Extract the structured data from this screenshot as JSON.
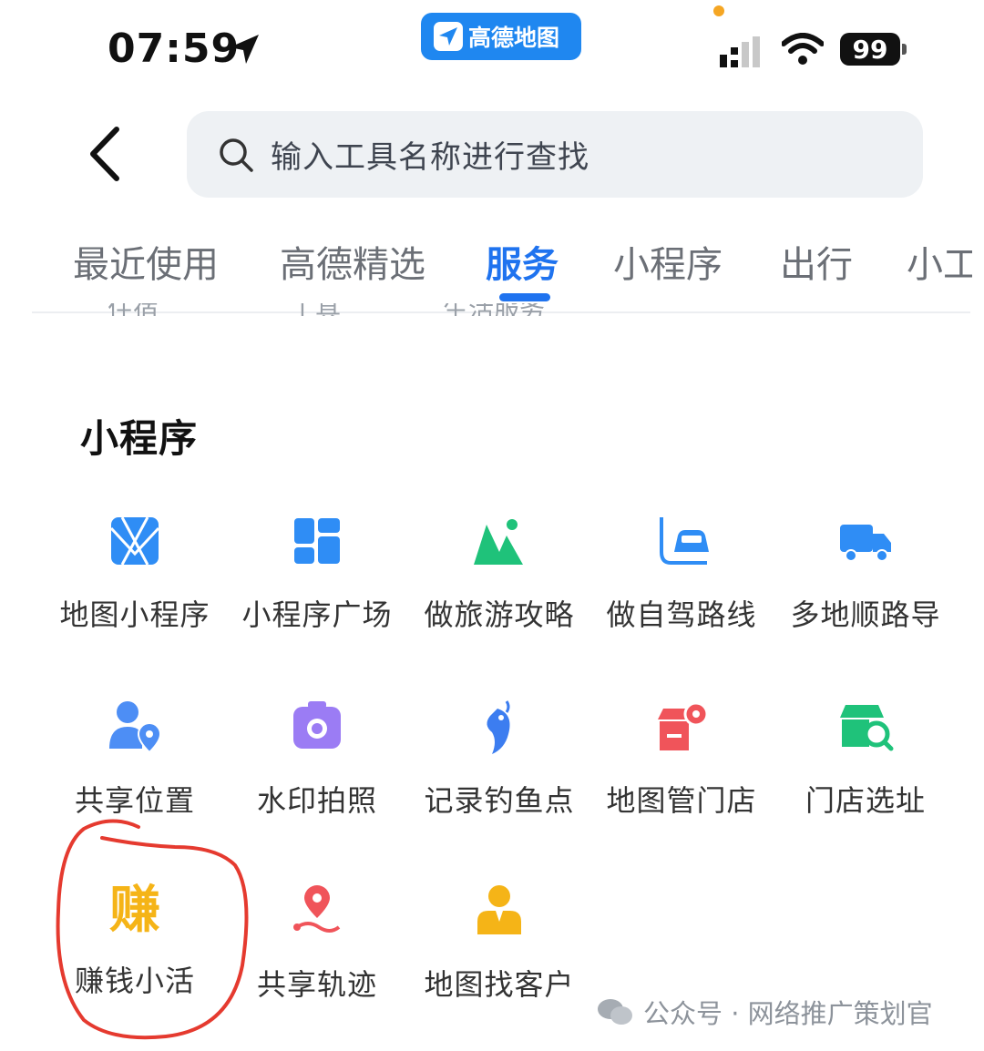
{
  "status_bar": {
    "time": "07:59",
    "app_badge": "高德地图",
    "battery": "99"
  },
  "header": {
    "search_placeholder": "输入工具名称进行查找"
  },
  "tabs": [
    {
      "label": "最近使用",
      "active": false
    },
    {
      "label": "高德精选",
      "active": false
    },
    {
      "label": "服务",
      "active": true
    },
    {
      "label": "小程序",
      "active": false
    },
    {
      "label": "出行",
      "active": false
    },
    {
      "label": "小工",
      "active": false
    }
  ],
  "partially_hidden_labels": [
    "住宿",
    "工具",
    "生活服务"
  ],
  "section": {
    "title": "小程序",
    "items": [
      {
        "label": "地图小程序",
        "icon": "map-miniprogram-icon",
        "color": "#2f8df5"
      },
      {
        "label": "小程序广场",
        "icon": "miniprogram-square-icon",
        "color": "#2f8df5"
      },
      {
        "label": "做旅游攻略",
        "icon": "travel-guide-icon",
        "color": "#1fc27a"
      },
      {
        "label": "做自驾路线",
        "icon": "self-drive-route-icon",
        "color": "#2f8df5"
      },
      {
        "label": "多地顺路导",
        "icon": "multi-stop-truck-icon",
        "color": "#2f8df5"
      },
      {
        "label": "共享位置",
        "icon": "share-location-icon",
        "color": "#4d8ef5"
      },
      {
        "label": "水印拍照",
        "icon": "watermark-camera-icon",
        "color": "#9b7cf4"
      },
      {
        "label": "记录钓鱼点",
        "icon": "fishing-spot-icon",
        "color": "#3c7df0"
      },
      {
        "label": "地图管门店",
        "icon": "store-manage-icon",
        "color": "#f0545a"
      },
      {
        "label": "门店选址",
        "icon": "store-location-icon",
        "color": "#1fc27a"
      },
      {
        "label": "赚钱小活",
        "icon": "earn-money-icon",
        "color": "#f5b417",
        "glyph": "赚"
      },
      {
        "label": "共享轨迹",
        "icon": "share-track-icon",
        "color": "#f0545a"
      },
      {
        "label": "地图找客户",
        "icon": "find-customer-icon",
        "color": "#f5b417"
      }
    ]
  },
  "watermark": "公众号 · 网络推广策划官"
}
